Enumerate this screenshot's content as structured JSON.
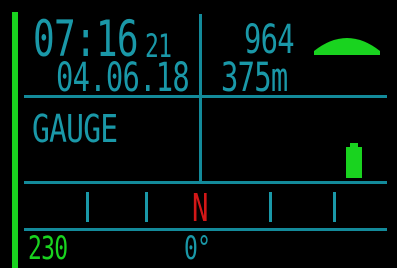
{
  "header": {
    "time_main": "07:16",
    "time_seconds": "21",
    "date": "04.06.18",
    "altitude_reading": "964",
    "height": "375m"
  },
  "mode": "GAUGE",
  "compass": {
    "heading_marker": "N"
  },
  "footer": {
    "left_value": "230",
    "center_value": "0°"
  },
  "icons": {
    "terrain": "mountain-icon",
    "battery": "battery-icon"
  },
  "colors": {
    "accent": "#1a98a8",
    "green": "#19d31f",
    "red": "#d21717",
    "background": "#000000"
  }
}
